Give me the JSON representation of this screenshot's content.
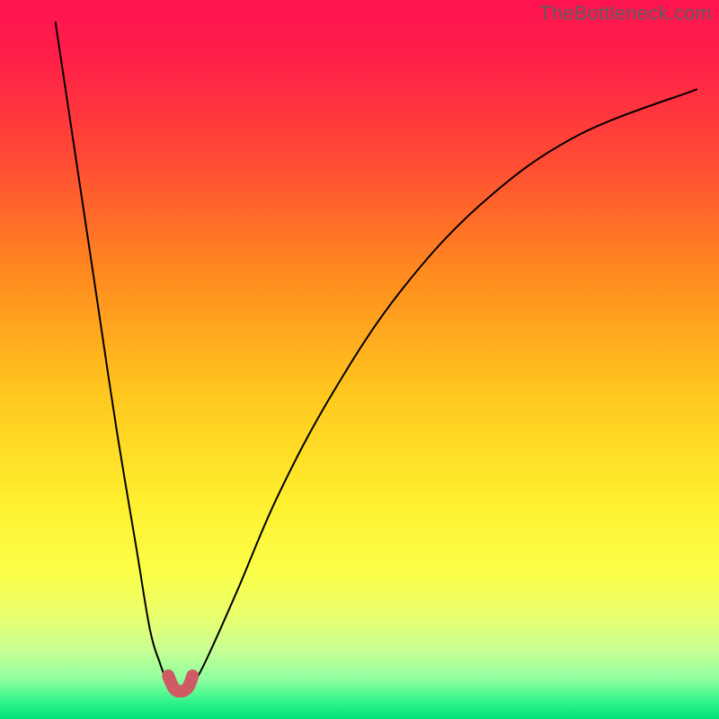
{
  "watermark": "TheBottleneck.com",
  "chart_data": {
    "type": "line",
    "title": "",
    "xlabel": "",
    "ylabel": "",
    "xlim": [
      0,
      100
    ],
    "ylim": [
      0,
      100
    ],
    "grid": false,
    "legend": false,
    "note": "Bottleneck-style V-curve on a vertical green→yellow→red gradient. Axes are unlabeled; values below are estimated relative percentages read from pixel position.",
    "curve_minimum_x": 23,
    "series": [
      {
        "name": "left-branch",
        "x": [
          5,
          8,
          11,
          14,
          17,
          19,
          20.5,
          21.5,
          22.5,
          23.5
        ],
        "y": [
          100,
          80,
          60,
          40,
          22,
          10,
          5,
          2.5,
          1.5,
          1.2
        ],
        "stroke": "#000000"
      },
      {
        "name": "right-branch",
        "x": [
          23.5,
          24.5,
          26,
          28,
          32,
          38,
          46,
          56,
          68,
          82,
          100
        ],
        "y": [
          1.2,
          1.5,
          3,
          7,
          16,
          30,
          45,
          60,
          73,
          83,
          90
        ],
        "stroke": "#000000"
      },
      {
        "name": "minimum-marker",
        "marker": "u-shape",
        "x": [
          21.7,
          22.3,
          22.8,
          23.5,
          24.2,
          24.8,
          25.3
        ],
        "y": [
          3.2,
          1.8,
          1.1,
          0.9,
          1.1,
          1.8,
          3.2
        ],
        "stroke": "#cf5a63",
        "stroke_width": 14
      }
    ],
    "background_gradient_stops": [
      {
        "offset": 0.0,
        "color": "#ff1450"
      },
      {
        "offset": 0.08,
        "color": "#ff1f49"
      },
      {
        "offset": 0.22,
        "color": "#ff4a34"
      },
      {
        "offset": 0.38,
        "color": "#ff8a1f"
      },
      {
        "offset": 0.55,
        "color": "#ffc81e"
      },
      {
        "offset": 0.7,
        "color": "#fff02f"
      },
      {
        "offset": 0.8,
        "color": "#fbff4a"
      },
      {
        "offset": 0.86,
        "color": "#e7ff70"
      },
      {
        "offset": 0.905,
        "color": "#c7ff93"
      },
      {
        "offset": 0.945,
        "color": "#8effa0"
      },
      {
        "offset": 0.975,
        "color": "#35f58a"
      },
      {
        "offset": 1.0,
        "color": "#00e27a"
      }
    ]
  }
}
